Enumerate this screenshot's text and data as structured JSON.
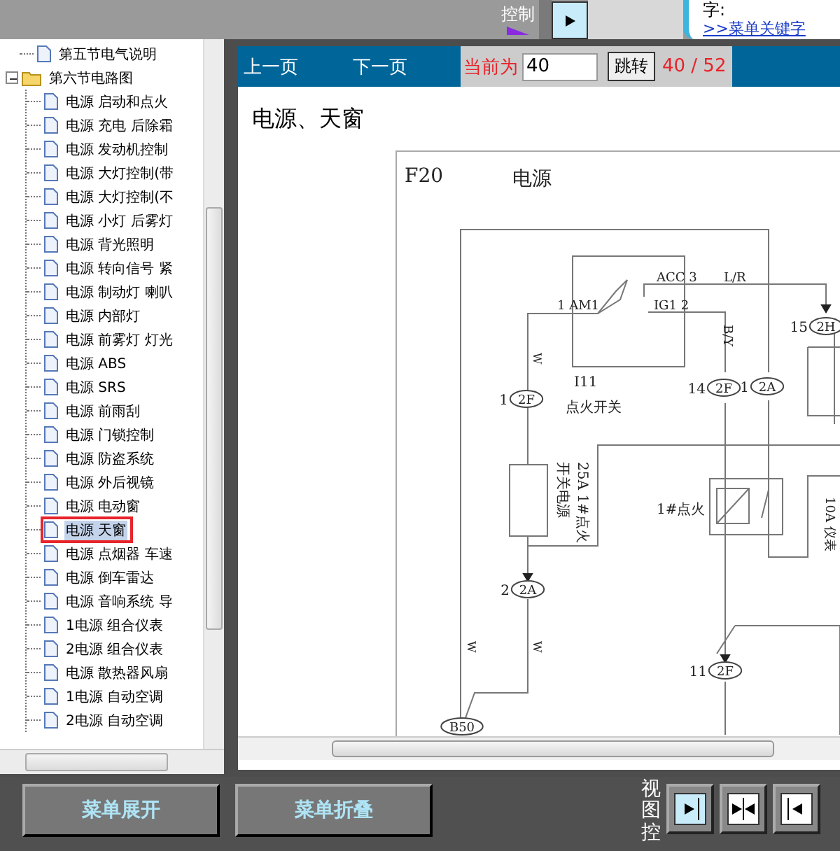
{
  "header": {
    "view_label": "控制",
    "search_label": "字:",
    "keyword_link": ">>菜单关键字"
  },
  "tree": [
    {
      "label": "第五节电气说明",
      "kind": "page",
      "selected": false
    },
    {
      "label": "第六节电路图",
      "kind": "folder",
      "selected": false,
      "expanded": true,
      "children": [
        {
          "label": "电源 启动和点火",
          "selected": false
        },
        {
          "label": "电源 充电 后除霜",
          "selected": false
        },
        {
          "label": "电源 发动机控制",
          "selected": false
        },
        {
          "label": "电源 大灯控制(带",
          "selected": false
        },
        {
          "label": "电源 大灯控制(不",
          "selected": false
        },
        {
          "label": "电源 小灯 后雾灯",
          "selected": false
        },
        {
          "label": "电源 背光照明",
          "selected": false
        },
        {
          "label": "电源 转向信号 紧",
          "selected": false
        },
        {
          "label": "电源 制动灯 喇叭",
          "selected": false
        },
        {
          "label": "电源 内部灯",
          "selected": false
        },
        {
          "label": "电源 前雾灯 灯光",
          "selected": false
        },
        {
          "label": "电源 ABS",
          "selected": false
        },
        {
          "label": "电源 SRS",
          "selected": false
        },
        {
          "label": "电源 前雨刮",
          "selected": false
        },
        {
          "label": "电源 门锁控制",
          "selected": false
        },
        {
          "label": "电源 防盗系统",
          "selected": false
        },
        {
          "label": "电源 外后视镜",
          "selected": false
        },
        {
          "label": "电源 电动窗",
          "selected": false
        },
        {
          "label": "电源 天窗",
          "selected": true
        },
        {
          "label": "电源 点烟器 车速",
          "selected": false
        },
        {
          "label": "电源 倒车雷达",
          "selected": false
        },
        {
          "label": "电源 音响系统 导",
          "selected": false
        },
        {
          "label": "1电源 组合仪表",
          "selected": false
        },
        {
          "label": "2电源 组合仪表",
          "selected": false
        },
        {
          "label": "电源 散热器风扇",
          "selected": false
        },
        {
          "label": "1电源 自动空调",
          "selected": false
        },
        {
          "label": "2电源 自动空调",
          "selected": false
        }
      ]
    }
  ],
  "toolbar": {
    "prev": "上一页",
    "next": "下一页",
    "current_label": "当前为",
    "page_value": "40",
    "go_button": "跳转",
    "page_count": "40 / 52"
  },
  "page_title": "电源、天窗",
  "diagram": {
    "labels": [
      "F20",
      "电源",
      "ACC 3",
      "L/R",
      "1 AM1",
      "IG1 2",
      "B/Y",
      "I11",
      "点火开关",
      "W",
      "25A 1#点火",
      "开关电源",
      "1#点火",
      "10A 仪表",
      "W",
      "W"
    ],
    "connectors": [
      {
        "pin": "1",
        "code": "2F"
      },
      {
        "pin": "14",
        "code": "2F"
      },
      {
        "pin": "1",
        "code": "2A"
      },
      {
        "pin": "15",
        "code": "2H"
      },
      {
        "pin": "2",
        "code": "2A"
      },
      {
        "pin": "11",
        "code": "2F"
      },
      {
        "code": "B50"
      }
    ]
  },
  "buttons": [
    "菜单展开",
    "菜单折叠"
  ],
  "view_control": {
    "label": "视图控"
  }
}
